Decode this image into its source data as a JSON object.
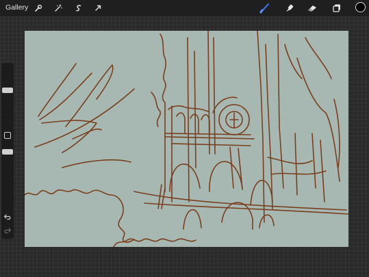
{
  "topbar": {
    "gallery_label": "Gallery",
    "left_tools": [
      "wrench-icon",
      "magic-wand-icon",
      "selection-icon",
      "transform-arrow-icon"
    ],
    "right_tools": [
      "brush-icon",
      "smudge-icon",
      "eraser-icon",
      "layers-icon"
    ],
    "active_tool": "brush-icon",
    "accent_color": "#3d7bff",
    "current_color": "#000000"
  },
  "sidebar": {
    "controls": [
      "brush-size-slider",
      "modify-button",
      "brush-opacity-slider",
      "undo-icon",
      "redo-icon"
    ]
  },
  "canvas": {
    "background_color": "#a7b8b2",
    "stroke_color": "#7a3e1c",
    "content": "sketch"
  }
}
